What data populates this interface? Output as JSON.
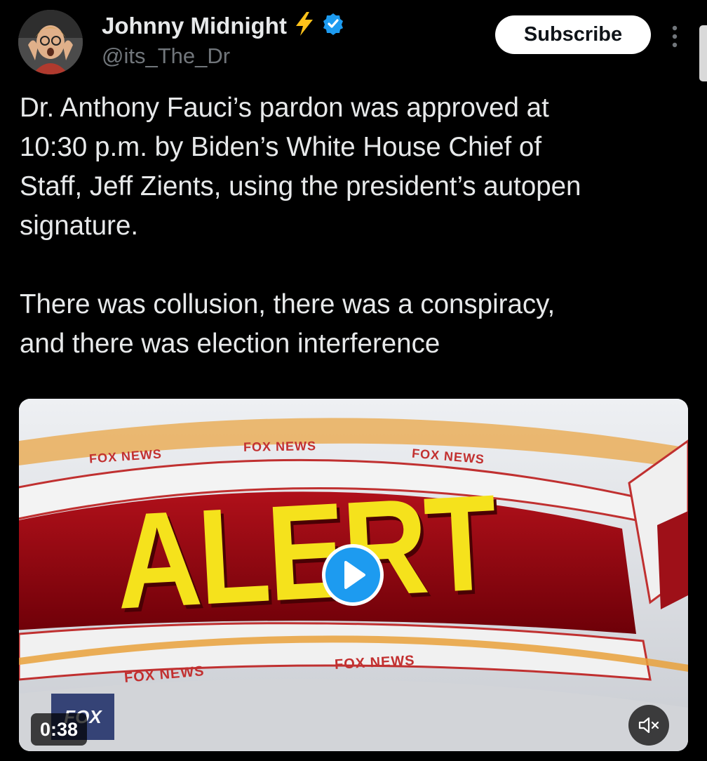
{
  "author": {
    "display_name": "Johnny Midnight",
    "handle": "@its_The_Dr",
    "emoji_icon": "lightning-bolt-icon",
    "verified_icon": "verified-badge-icon",
    "accent_color": "#1d9bf0"
  },
  "header": {
    "subscribe_label": "Subscribe",
    "more_icon": "more-options-icon"
  },
  "tweet": {
    "text": "Dr. Anthony Fauci’s pardon was approved at\n10:30 p.m. by Biden’s White House Chief of\nStaff, Jeff Zients, using the president’s autopen\nsignature.\n\nThere was collusion, there was a conspiracy,\nand there was election interference"
  },
  "media": {
    "type": "video",
    "overlay_text": "ALERT",
    "network_band_text": "FOX NEWS",
    "corner_logo_text": "FOX",
    "duration": "0:38",
    "play_icon": "play-icon",
    "mute_icon": "muted-speaker-icon"
  }
}
